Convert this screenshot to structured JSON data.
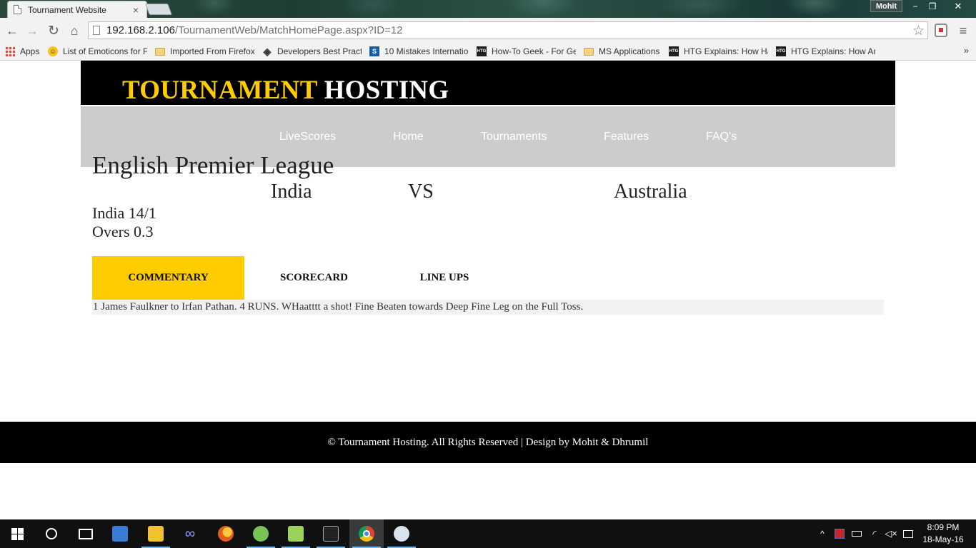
{
  "browser": {
    "tab_title": "Tournament Website",
    "tab_close": "×",
    "profile_name": "Mohit",
    "window_controls": {
      "minimize": "−",
      "restore": "❐",
      "close": "✕"
    },
    "nav": {
      "back": "←",
      "forward": "→",
      "reload": "↻",
      "home": "⌂",
      "menu": "≡",
      "star": "☆"
    },
    "url_host": "192.168.2.106",
    "url_path": "/TournamentWeb/MatchHomePage.aspx?ID=12",
    "bookmarks": [
      {
        "label": "Apps",
        "icon": "apps-grid-icon"
      },
      {
        "label": "List of Emoticons for F",
        "icon": "smiley-icon"
      },
      {
        "label": "Imported From Firefox",
        "icon": "folder-icon"
      },
      {
        "label": "Developers Best Practi",
        "icon": "diamond-icon"
      },
      {
        "label": "10 Mistakes Internatio",
        "icon": "stackoverflow-icon"
      },
      {
        "label": "How-To Geek - For Ge",
        "icon": "htg-icon"
      },
      {
        "label": "MS Applications",
        "icon": "folder-icon"
      },
      {
        "label": "HTG Explains: How Ha",
        "icon": "htg-icon"
      },
      {
        "label": "HTG Explains: How An",
        "icon": "htg-icon"
      }
    ],
    "bookmarks_overflow": "»"
  },
  "site": {
    "logo_part1": "TOURNAMENT",
    "logo_part2": "HOSTING",
    "nav": [
      "LiveScores",
      "Home",
      "Tournaments",
      "Features",
      "FAQ's"
    ]
  },
  "match": {
    "league": "English Premier League",
    "team_home": "India",
    "vs": "VS",
    "team_away": "Australia",
    "score": "India 14/1",
    "overs": "Overs 0.3",
    "tabs": [
      "COMMENTARY",
      "SCORECARD",
      "LINE UPS"
    ],
    "active_tab": "COMMENTARY",
    "commentary": "1 James Faulkner to Irfan Pathan. 4 RUNS. WHaatttt a shot! Fine Beaten towards Deep Fine Leg on the Full Toss."
  },
  "footer": {
    "text": "© Tournament Hosting. All Rights Reserved | Design by Mohit & Dhrumil"
  },
  "taskbar": {
    "apps": [
      "start-icon",
      "search-icon",
      "task-view-icon",
      "media-player-icon",
      "file-explorer-icon",
      "visual-studio-icon",
      "firefox-icon",
      "android-studio-icon",
      "notepad-plus-plus-icon",
      "command-prompt-icon",
      "chrome-icon",
      "paint-icon"
    ],
    "tray_chevron": "^",
    "clock_time": "8:09 PM",
    "clock_date": "18-May-16"
  },
  "colors": {
    "accent_yellow": "#ffcc00",
    "header_black": "#000000",
    "nav_gray": "#cccccc",
    "commentary_bg": "#f2f2f2"
  }
}
